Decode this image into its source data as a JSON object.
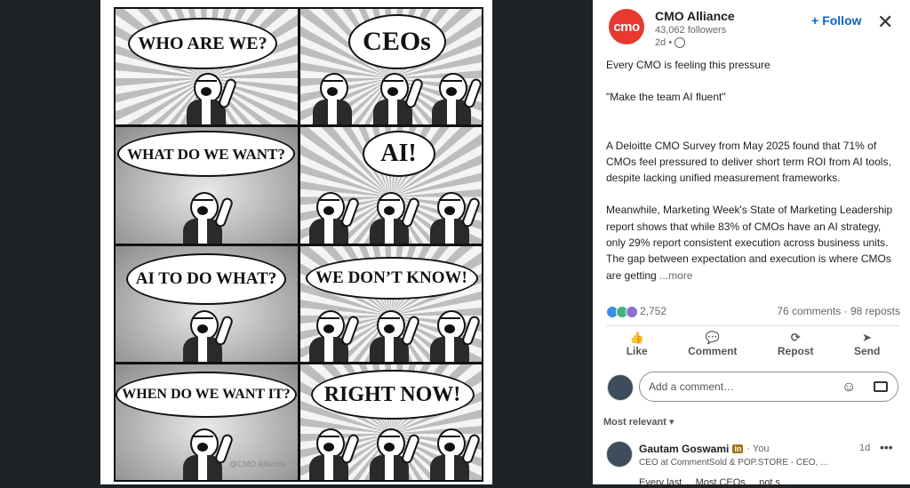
{
  "comic": {
    "panels": [
      {
        "text": "WHO ARE WE?"
      },
      {
        "text": "CEOs"
      },
      {
        "text": "WHAT DO WE WANT?"
      },
      {
        "text": "AI!"
      },
      {
        "text": "AI TO DO WHAT?"
      },
      {
        "text": "WE DON’T KNOW!"
      },
      {
        "text": "WHEN DO WE WANT IT?"
      },
      {
        "text": "RIGHT NOW!"
      }
    ],
    "watermark": "@CMO Alliance"
  },
  "post": {
    "author": {
      "logo_text": "cmo",
      "name": "CMO Alliance",
      "followers": "43,062 followers",
      "time": "2d •"
    },
    "follow_label": "Follow",
    "paragraphs": [
      "Every CMO is feeling this pressure",
      "\"Make the team AI fluent\"",
      "A Deloitte CMO Survey from May 2025 found that 71% of CMOs feel pressured to deliver short term ROI from AI tools, despite lacking unified measurement frameworks.",
      "Meanwhile, Marketing Week's State of Marketing Leadership report shows that while 83% of CMOs have an AI strategy, only 29% report consistent execution across business units. The gap between expectation and execution is where CMOs are getting"
    ],
    "more_label": "...more",
    "reaction_count": "2,752",
    "comments_reposts": "76 comments · 98 reposts",
    "actions": [
      {
        "label": "Like",
        "icon": "👍"
      },
      {
        "label": "Comment",
        "icon": "💬"
      },
      {
        "label": "Repost",
        "icon": "⟳"
      },
      {
        "label": "Send",
        "icon": "➤"
      }
    ],
    "comment_placeholder": "Add a comment…",
    "sort_label": "Most relevant",
    "top_comment": {
      "name": "Gautam Goswami",
      "badge": "in",
      "you": "· You",
      "title": "CEO at CommentSold & POP.STORE - CEO, ...",
      "time": "1d",
      "body": "Every last ... Most CEOs ... not s..."
    }
  }
}
